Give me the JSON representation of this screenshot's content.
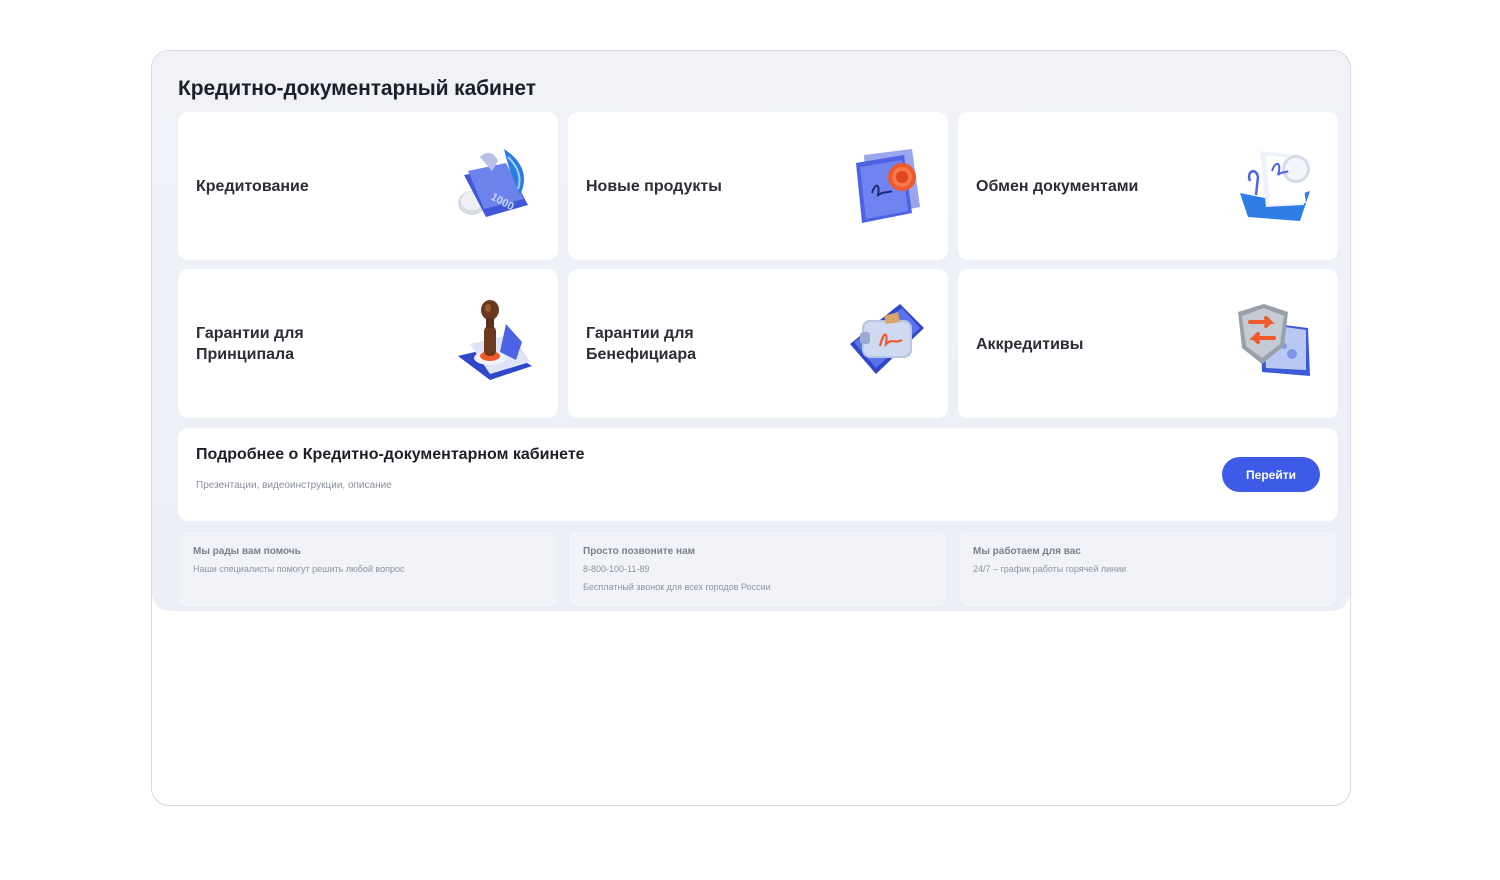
{
  "title": "Кредитно-документарный кабинет",
  "tiles": [
    {
      "label": "Кредитование",
      "icon": "credit-money-icon"
    },
    {
      "label": "Новые продукты",
      "icon": "new-products-document-icon"
    },
    {
      "label": "Обмен документами",
      "icon": "document-exchange-icon"
    },
    {
      "label": "Гарантии для\nПринципала",
      "icon": "stamp-icon"
    },
    {
      "label": "Гарантии для\nБенефициара",
      "icon": "wallet-signature-icon"
    },
    {
      "label": "Аккредитивы",
      "icon": "shield-exchange-icon"
    }
  ],
  "info": {
    "title": "Подробнее о Кредитно-документарном кабинете",
    "subtitle": "Презентации, видеоинструкции, описание",
    "button": "Перейти"
  },
  "help": [
    {
      "title": "Мы рады вам помочь",
      "lines": [
        "Наши специалисты помогут решить любой вопрос"
      ]
    },
    {
      "title": "Просто позвоните нам",
      "lines": [
        "8-800-100-11-89",
        "Бесплатный звонок для всех городов России"
      ]
    },
    {
      "title": "Мы работаем для вас",
      "lines": [
        "24/7 – график работы горячей линии"
      ]
    }
  ],
  "colors": {
    "accent": "#3d5be6",
    "card": "#ffffff",
    "panel": "#eef1f8"
  }
}
